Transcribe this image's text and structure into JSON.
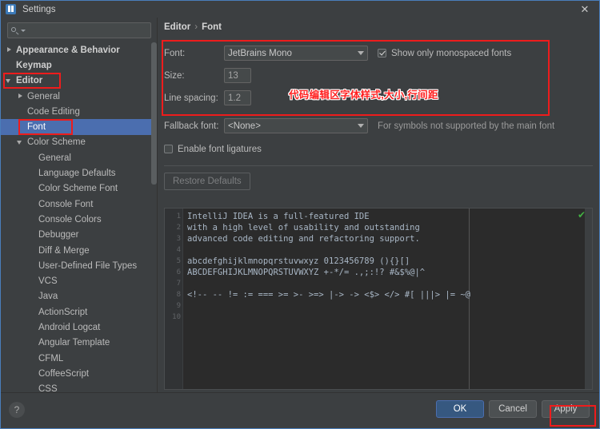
{
  "window": {
    "title": "Settings",
    "app_icon": "intellij-logo-icon",
    "close_icon": "close-icon"
  },
  "search": {
    "value": "",
    "placeholder": "",
    "icon": "search-icon",
    "dropdown_icon": "chevron-down-icon"
  },
  "sidebar": {
    "items": [
      {
        "label": "Appearance & Behavior",
        "arrow": "right",
        "indent": 0,
        "bold": true,
        "selected": false
      },
      {
        "label": "Keymap",
        "arrow": "none",
        "indent": 0,
        "bold": true,
        "selected": false
      },
      {
        "label": "Editor",
        "arrow": "down",
        "indent": 0,
        "bold": true,
        "selected": false
      },
      {
        "label": "General",
        "arrow": "right",
        "indent": 1,
        "bold": false,
        "selected": false
      },
      {
        "label": "Code Editing",
        "arrow": "none",
        "indent": 1,
        "bold": false,
        "selected": false
      },
      {
        "label": "Font",
        "arrow": "none",
        "indent": 1,
        "bold": false,
        "selected": true
      },
      {
        "label": "Color Scheme",
        "arrow": "down",
        "indent": 1,
        "bold": false,
        "selected": false
      },
      {
        "label": "General",
        "arrow": "none",
        "indent": 2,
        "bold": false,
        "selected": false
      },
      {
        "label": "Language Defaults",
        "arrow": "none",
        "indent": 2,
        "bold": false,
        "selected": false
      },
      {
        "label": "Color Scheme Font",
        "arrow": "none",
        "indent": 2,
        "bold": false,
        "selected": false
      },
      {
        "label": "Console Font",
        "arrow": "none",
        "indent": 2,
        "bold": false,
        "selected": false
      },
      {
        "label": "Console Colors",
        "arrow": "none",
        "indent": 2,
        "bold": false,
        "selected": false
      },
      {
        "label": "Debugger",
        "arrow": "none",
        "indent": 2,
        "bold": false,
        "selected": false
      },
      {
        "label": "Diff & Merge",
        "arrow": "none",
        "indent": 2,
        "bold": false,
        "selected": false
      },
      {
        "label": "User-Defined File Types",
        "arrow": "none",
        "indent": 2,
        "bold": false,
        "selected": false
      },
      {
        "label": "VCS",
        "arrow": "none",
        "indent": 2,
        "bold": false,
        "selected": false
      },
      {
        "label": "Java",
        "arrow": "none",
        "indent": 2,
        "bold": false,
        "selected": false
      },
      {
        "label": "ActionScript",
        "arrow": "none",
        "indent": 2,
        "bold": false,
        "selected": false
      },
      {
        "label": "Android Logcat",
        "arrow": "none",
        "indent": 2,
        "bold": false,
        "selected": false
      },
      {
        "label": "Angular Template",
        "arrow": "none",
        "indent": 2,
        "bold": false,
        "selected": false
      },
      {
        "label": "CFML",
        "arrow": "none",
        "indent": 2,
        "bold": false,
        "selected": false
      },
      {
        "label": "CoffeeScript",
        "arrow": "none",
        "indent": 2,
        "bold": false,
        "selected": false
      },
      {
        "label": "CSS",
        "arrow": "none",
        "indent": 2,
        "bold": false,
        "selected": false
      }
    ]
  },
  "breadcrumb": {
    "parent": "Editor",
    "separator": "›",
    "current": "Font"
  },
  "form": {
    "font_label": "Font:",
    "font_value": "JetBrains Mono",
    "monospaced_label": "Show only monospaced fonts",
    "monospaced_checked": true,
    "size_label": "Size:",
    "size_value": "13",
    "line_spacing_label": "Line spacing:",
    "line_spacing_value": "1.2",
    "fallback_label": "Fallback font:",
    "fallback_value": "<None>",
    "fallback_hint": "For symbols not supported by the main font",
    "ligatures_label": "Enable font ligatures",
    "ligatures_checked": false,
    "restore_defaults_label": "Restore Defaults"
  },
  "preview": {
    "ok_icon": "checkmark-icon",
    "lines": [
      {
        "n": "1",
        "text": "IntelliJ IDEA is a full-featured IDE"
      },
      {
        "n": "2",
        "text": "with a high level of usability and outstanding"
      },
      {
        "n": "3",
        "text": "advanced code editing and refactoring support."
      },
      {
        "n": "4",
        "text": ""
      },
      {
        "n": "5",
        "text": "abcdefghijklmnopqrstuvwxyz 0123456789 (){}[]"
      },
      {
        "n": "6",
        "text": "ABCDEFGHIJKLMNOPQRSTUVWXYZ +-*/= .,;:!? #&$%@|^"
      },
      {
        "n": "7",
        "text": ""
      },
      {
        "n": "8",
        "text": "<!-- -- != := === >= >- >=> |-> -> <$> </> #[ |||> |= ~@"
      },
      {
        "n": "9",
        "text": ""
      },
      {
        "n": "10",
        "text": ""
      }
    ]
  },
  "footer": {
    "help_label": "?",
    "ok_label": "OK",
    "cancel_label": "Cancel",
    "apply_label": "Apply"
  },
  "annotations": {
    "note_text": "代码编辑区字体样式,大小,行间距",
    "highlight_color": "#ee1c1c"
  }
}
